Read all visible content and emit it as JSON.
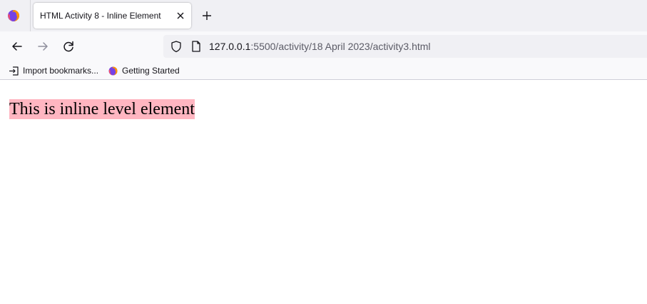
{
  "browser": {
    "tab": {
      "title": "HTML Activity 8 - Inline Element",
      "icon": "firefox-icon"
    },
    "icons": {
      "firefox": "firefox-icon",
      "close": "close-icon",
      "new_tab": "plus-icon",
      "back": "arrow-left-icon",
      "forward": "arrow-right-icon",
      "reload": "reload-icon",
      "tracking": "shield-icon",
      "page": "page-icon"
    },
    "urlbar": {
      "host": "127.0.0.1",
      "rest": ":5500/activity/18 April 2023/activity3.html"
    },
    "bookmarks": [
      {
        "label": "Import bookmarks...",
        "icon": "import-icon"
      },
      {
        "label": "Getting Started",
        "icon": "firefox-icon"
      }
    ]
  },
  "page": {
    "inline_text": "This is inline level element",
    "highlight_color": "#ffb6c1"
  }
}
